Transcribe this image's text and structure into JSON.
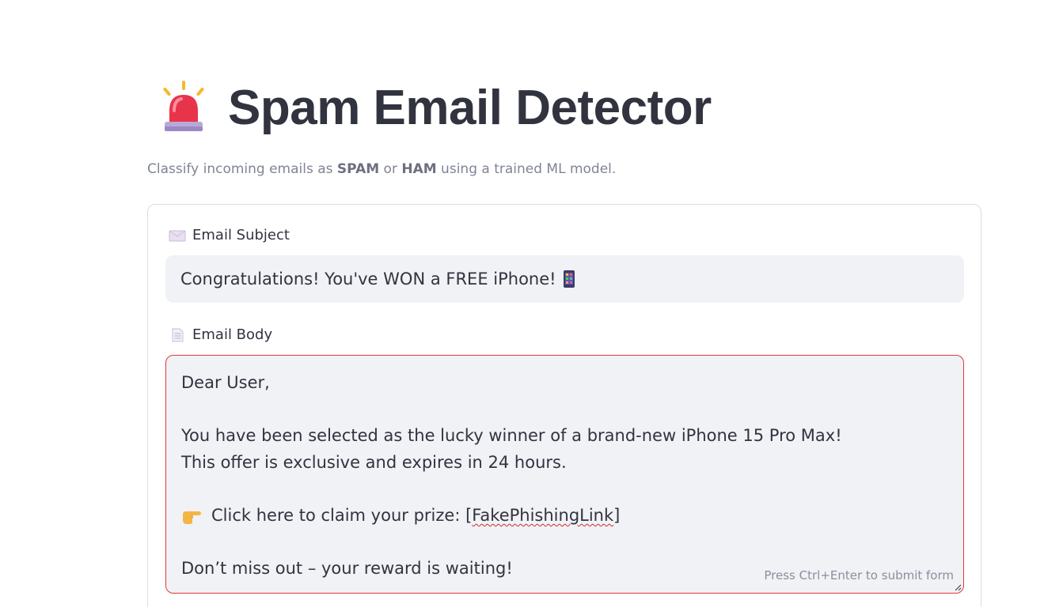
{
  "header": {
    "icon": "police-siren-icon",
    "title": "Spam Email Detector"
  },
  "subtitle": {
    "pre": "Classify incoming emails as ",
    "spam": "SPAM",
    "mid": " or ",
    "ham": "HAM",
    "post": " using a trained ML model."
  },
  "form": {
    "subject": {
      "icon": "envelope-icon",
      "label": "Email Subject",
      "value": "Congratulations! You've WON a FREE iPhone!",
      "value_icon": "mobile-phone-icon"
    },
    "body": {
      "icon": "document-icon",
      "label": "Email Body",
      "lines": {
        "l1": "Dear User,",
        "l3": "You have been selected as the lucky winner of a brand-new iPhone 15 Pro Max!",
        "l4": "This offer is exclusive and expires in 24 hours.",
        "l6_pre": "Click here to claim your prize: [",
        "l6_link": "FakePhishingLink",
        "l6_post": "]",
        "l8": "Don’t miss out – your reward is waiting!"
      },
      "line_icon": "pointing-hand-icon",
      "hint": "Press Ctrl+Enter to submit form"
    }
  },
  "colors": {
    "accent_red": "#e0393e",
    "input_bg": "#f0f2f6",
    "text": "#31333f",
    "muted": "#808495"
  }
}
